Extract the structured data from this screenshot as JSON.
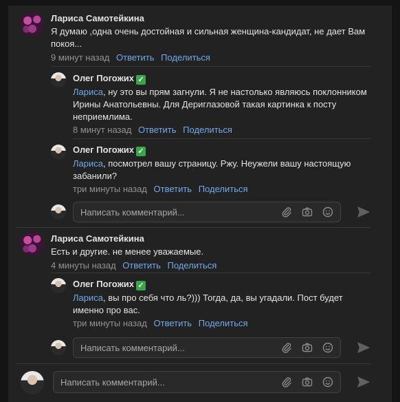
{
  "comments": [
    {
      "author": "Лариса Самотейкина",
      "text": "Я думаю ,одна очень достойная и сильная женщина-кандидат, не дает Вам покоя...",
      "time": "9 минут назад",
      "reply_label": "Ответить",
      "share_label": "Поделиться"
    },
    {
      "author": "Олег Погожих",
      "verified_icon": "✅",
      "mention": "Лариса",
      "text": ", ну это вы прям загнули. Я не настолько являюсь поклонником Ирины Анатольевны. Для Дериглазовой такая картинка к посту неприемлима.",
      "time": "8 минут назад",
      "reply_label": "Ответить",
      "share_label": "Поделиться"
    },
    {
      "author": "Олег Погожих",
      "verified_icon": "✅",
      "mention": "Лариса",
      "text": ", посмотрел вашу страницу. Ржу. Неужели вашу настоящую забанили?",
      "time": "три минуты назад",
      "reply_label": "Ответить",
      "share_label": "Поделиться"
    },
    {
      "author": "Лариса Самотейкина",
      "text": "Есть и другие. не менее уважаемые.",
      "time": "4 минуты назад",
      "reply_label": "Ответить",
      "share_label": "Поделиться"
    },
    {
      "author": "Олег Погожих",
      "verified_icon": "✅",
      "mention": "Лариса",
      "text": ", вы про себя что ль?))) Тогда, да, вы угадали. Пост будет именно про вас.",
      "time": "три минуты назад",
      "reply_label": "Ответить",
      "share_label": "Поделиться"
    }
  ],
  "reply_input_placeholder": "Написать комментарий...",
  "main_input_placeholder": "Написать комментарий...",
  "colors": {
    "accent": "#71aaeb",
    "background": "#222222",
    "text": "#e1e3e6",
    "meta": "#939393"
  }
}
